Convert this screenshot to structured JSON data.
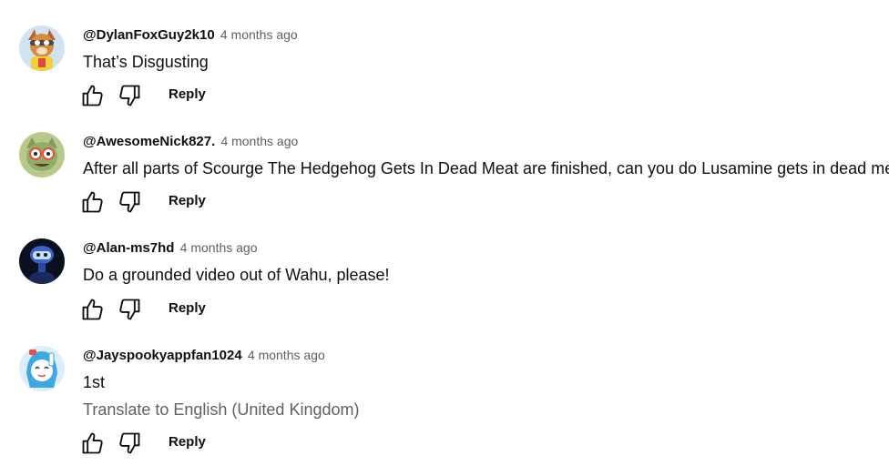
{
  "comments": [
    {
      "author": "@DylanFoxGuy2k10",
      "time": "4 months ago",
      "text": "That’s Disgusting",
      "reply_label": "Reply",
      "avatar_colors": {
        "bg": "#cfe3f2",
        "main": "#d98a3a",
        "accent": "#f0d040"
      }
    },
    {
      "author": "@AwesomeNick827.",
      "time": "4 months ago",
      "text": "After all parts of Scourge The Hedgehog Gets In Dead Meat are finished, can you do Lusamine gets in dead meat",
      "reply_label": "Reply",
      "avatar_colors": {
        "bg": "#b9c98a",
        "main": "#8fae6a",
        "accent": "#e8503a"
      }
    },
    {
      "author": "@Alan-ms7hd",
      "time": "4 months ago",
      "text": "Do a grounded video out of Wahu, please!",
      "reply_label": "Reply",
      "avatar_colors": {
        "bg": "#0b1020",
        "main": "#3a62c8",
        "accent": "#bfe0ff"
      }
    },
    {
      "author": "@Jayspookyappfan1024",
      "time": "4 months ago",
      "text": "1st",
      "translate_label": "Translate to English (United Kingdom)",
      "reply_label": "Reply",
      "avatar_colors": {
        "bg": "#dbeefc",
        "main": "#3fa8e0",
        "accent": "#ffffff"
      }
    }
  ]
}
